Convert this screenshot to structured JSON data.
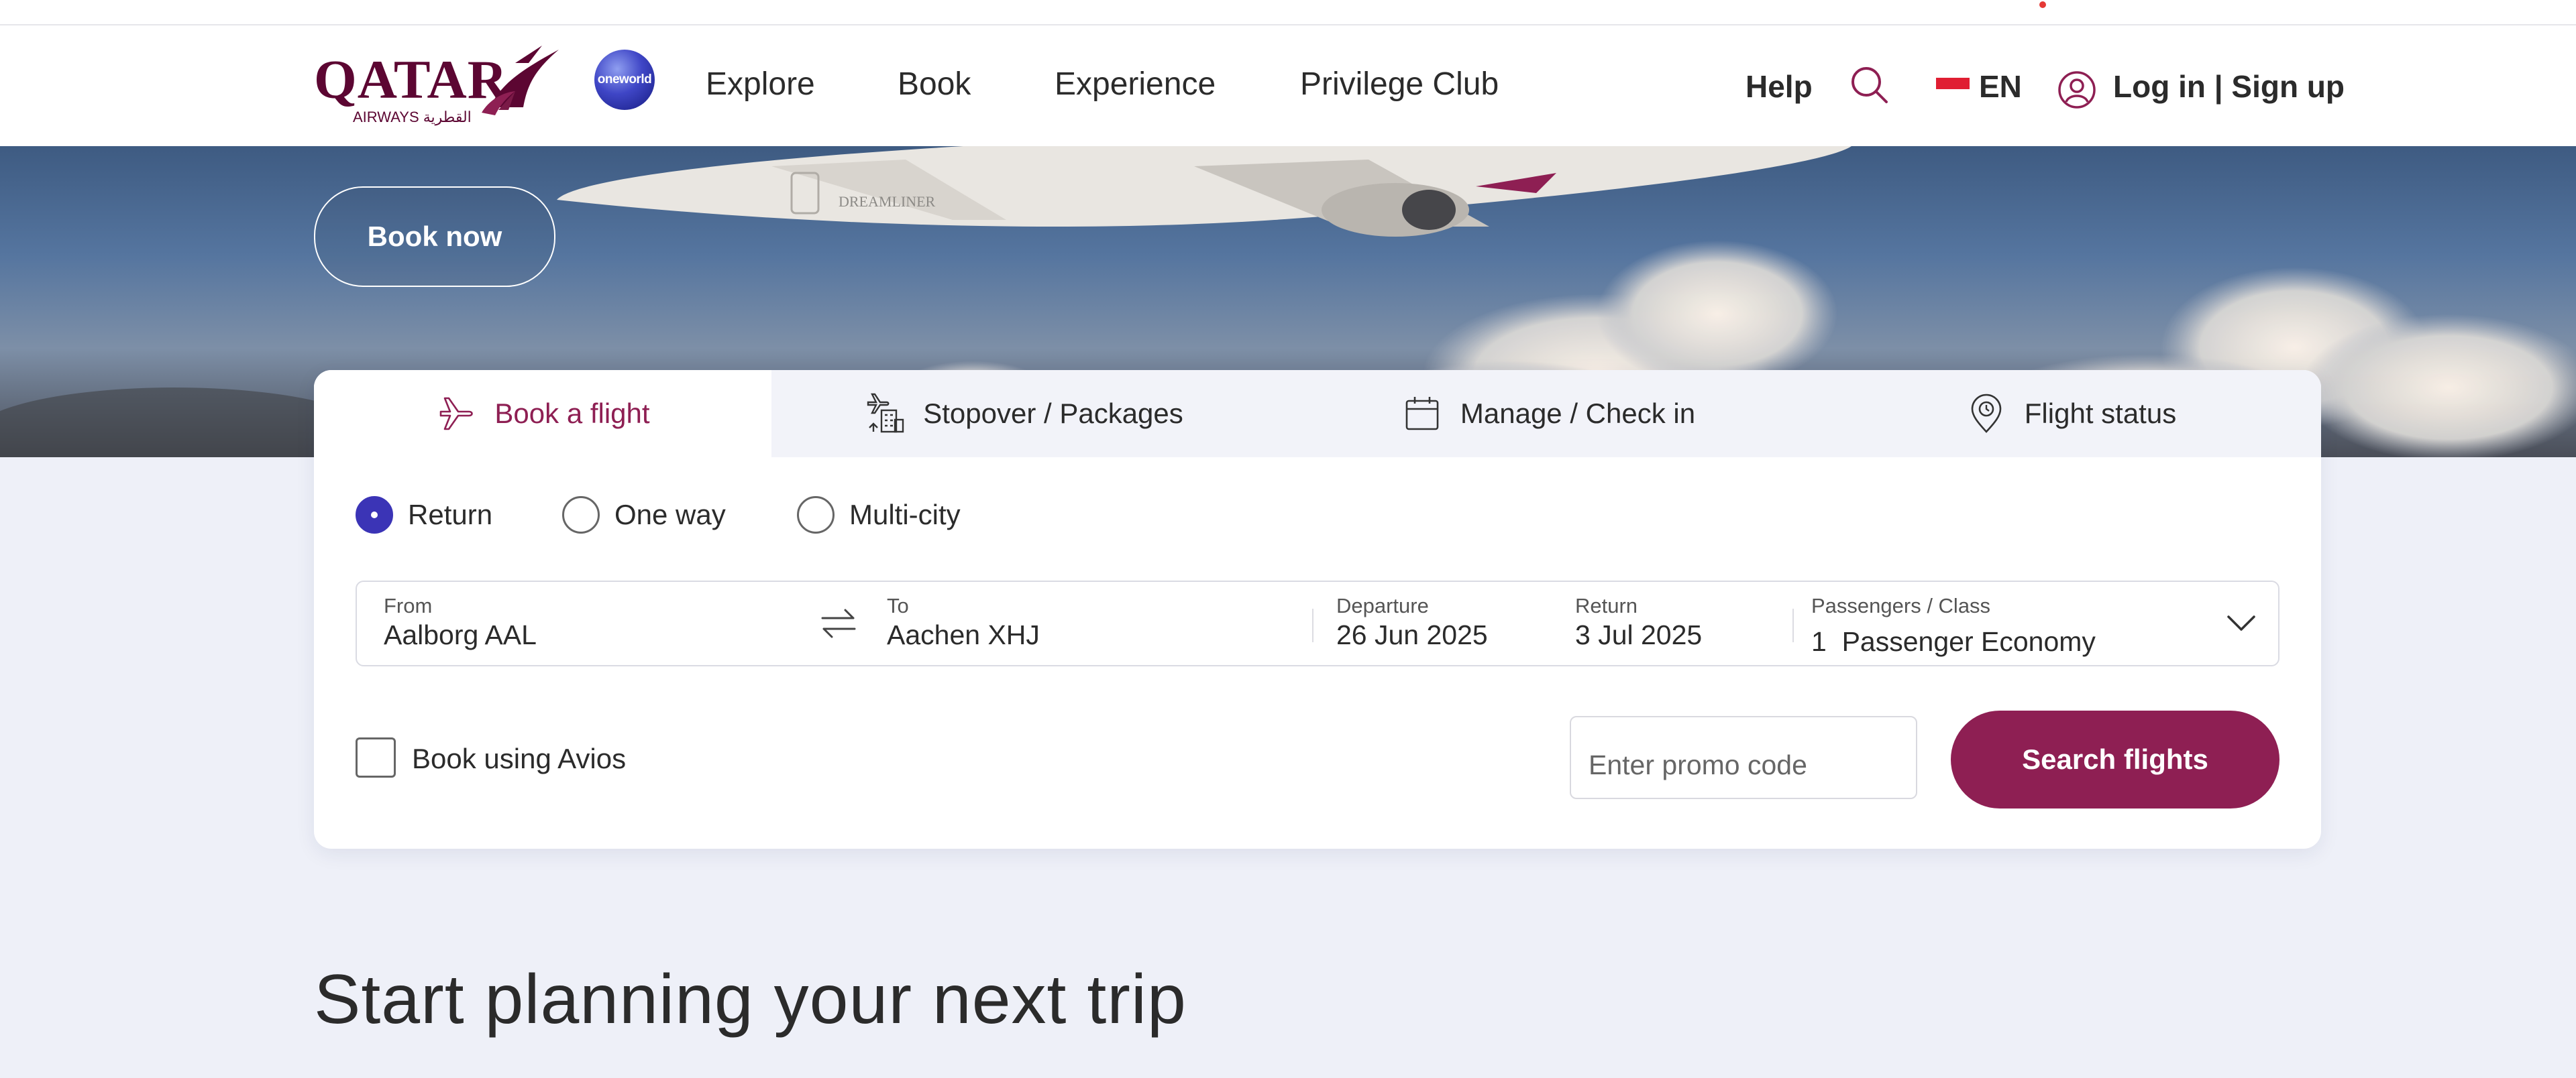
{
  "header": {
    "logo_text": "QATAR",
    "logo_sub": "AIRWAYS القطرية",
    "alliance": "oneworld",
    "nav": [
      "Explore",
      "Book",
      "Experience",
      "Privilege Club"
    ],
    "help": "Help",
    "language": "EN",
    "login": "Log in | Sign up"
  },
  "hero": {
    "book_now": "Book now",
    "aircraft_marking": "DREAMLINER"
  },
  "booking": {
    "tabs": [
      {
        "label": "Book a flight",
        "icon": "plane-icon",
        "active": true
      },
      {
        "label": "Stopover / Packages",
        "icon": "stopover-icon",
        "active": false
      },
      {
        "label": "Manage / Check in",
        "icon": "calendar-icon",
        "active": false
      },
      {
        "label": "Flight status",
        "icon": "location-pin-icon",
        "active": false
      }
    ],
    "trip_types": [
      {
        "label": "Return",
        "selected": true
      },
      {
        "label": "One way",
        "selected": false
      },
      {
        "label": "Multi-city",
        "selected": false
      }
    ],
    "from": {
      "label": "From",
      "value": "Aalborg AAL"
    },
    "to": {
      "label": "To",
      "value": "Aachen XHJ"
    },
    "departure": {
      "label": "Departure",
      "value": "26 Jun 2025"
    },
    "return": {
      "label": "Return",
      "value": "3 Jul 2025"
    },
    "passengers": {
      "label": "Passengers / Class",
      "value": "1  Passenger Economy"
    },
    "avios_label": "Book using Avios",
    "avios_checked": false,
    "promo_placeholder": "Enter promo code",
    "search_button": "Search flights"
  },
  "section_title": "Start planning your next trip",
  "colors": {
    "brand": "#8e1f53",
    "radio_accent": "#3b34b6",
    "page_bg": "#eef0f8"
  }
}
